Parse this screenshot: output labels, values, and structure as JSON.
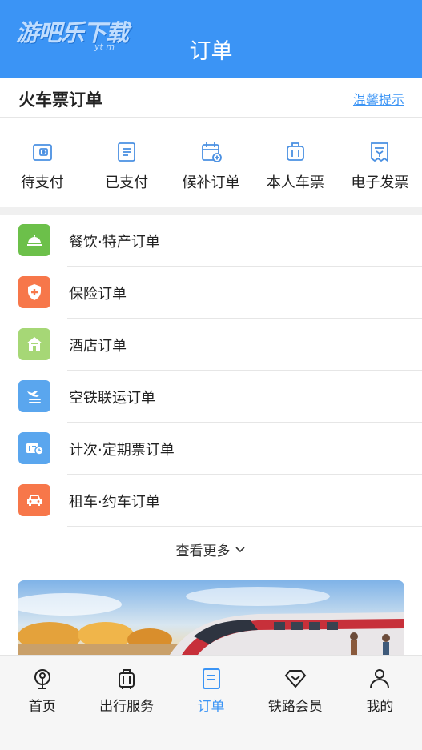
{
  "header": {
    "title": "订单",
    "watermark": "游吧乐下载",
    "watermark_sub": "yt  m"
  },
  "section": {
    "title": "火车票订单",
    "tip_link": "温馨提示"
  },
  "status_items": [
    {
      "label": "待支付",
      "icon": "wallet-icon"
    },
    {
      "label": "已支付",
      "icon": "receipt-icon"
    },
    {
      "label": "候补订单",
      "icon": "calendar-add-icon"
    },
    {
      "label": "本人车票",
      "icon": "luggage-icon"
    },
    {
      "label": "电子发票",
      "icon": "invoice-icon"
    }
  ],
  "order_types": [
    {
      "label": "餐饮·特产订单",
      "icon": "food-cloche-icon",
      "color": "#6cc04a"
    },
    {
      "label": "保险订单",
      "icon": "shield-plus-icon",
      "color": "#f7774a"
    },
    {
      "label": "酒店订单",
      "icon": "hotel-house-icon",
      "color": "#a6d776"
    },
    {
      "label": "空铁联运订单",
      "icon": "plane-train-icon",
      "color": "#5aa6ee"
    },
    {
      "label": "计次·定期票订单",
      "icon": "ticket-clock-icon",
      "color": "#5aa6ee"
    },
    {
      "label": "租车·约车订单",
      "icon": "car-icon",
      "color": "#f7774a"
    }
  ],
  "more": {
    "label": "查看更多"
  },
  "tabs": [
    {
      "label": "首页",
      "icon": "railway-logo-icon",
      "active": false
    },
    {
      "label": "出行服务",
      "icon": "luggage-icon",
      "active": false
    },
    {
      "label": "订单",
      "icon": "order-doc-icon",
      "active": true
    },
    {
      "label": "铁路会员",
      "icon": "diamond-icon",
      "active": false
    },
    {
      "label": "我的",
      "icon": "user-icon",
      "active": false
    }
  ],
  "colors": {
    "primary": "#3b94f5",
    "text": "#222222",
    "icon_blue": "#4a90e2"
  }
}
